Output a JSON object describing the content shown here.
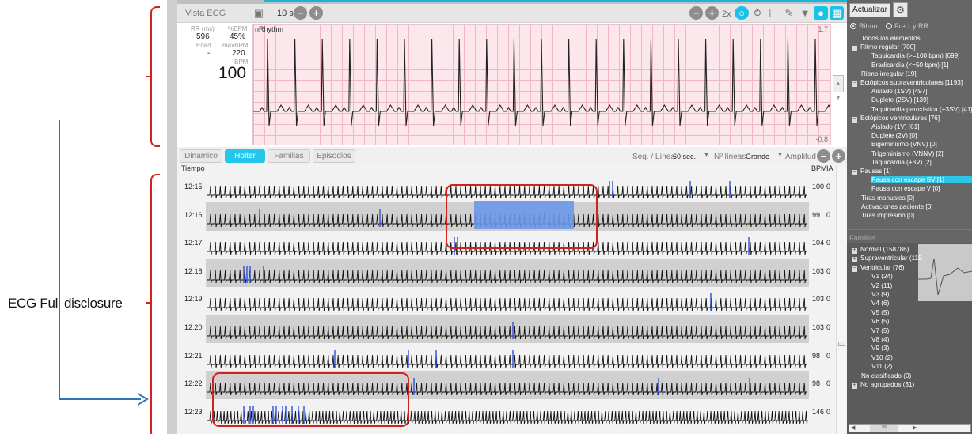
{
  "annotation": {
    "label": "ECG Full disclosure"
  },
  "ecg_toolbar": {
    "title": "Vista ECG",
    "seconds": "10 s",
    "zoom": "2x"
  },
  "ecg_stats": {
    "rr_label": "RR (ms)",
    "rr_value": "596",
    "pbpm_label": "%BPM",
    "pbpm_value": "45%",
    "age_label": "Edad",
    "age_value": "-",
    "maxbpm_label": "maxBPM",
    "maxbpm_value": "220",
    "bpm_label": "BPM",
    "bpm_value": "100"
  },
  "ecg_strip": {
    "rhythm": "nRhythm",
    "scale_top": "1,7",
    "scale_bottom": "-0,8"
  },
  "tabs": [
    {
      "label": "Dinámico",
      "active": false
    },
    {
      "label": "Holter",
      "active": true
    },
    {
      "label": "Familias",
      "active": false
    },
    {
      "label": "Episodios",
      "active": false
    }
  ],
  "holter_controls": {
    "seg_label": "Seg. / Línea",
    "seg_value": "60 sec.",
    "lines_label": "Nº líneas",
    "lines_value": "Grande",
    "amp_label": "Amplitud"
  },
  "holter_header": {
    "time": "Tiempo",
    "bpm": "BPM",
    "ia": "IA"
  },
  "holter_rows": [
    {
      "time": "12:15",
      "bpm": "100",
      "ia": "0"
    },
    {
      "time": "12:16",
      "bpm": "99",
      "ia": "0"
    },
    {
      "time": "12:17",
      "bpm": "104",
      "ia": "0"
    },
    {
      "time": "12:18",
      "bpm": "103",
      "ia": "0"
    },
    {
      "time": "12:19",
      "bpm": "103",
      "ia": "0"
    },
    {
      "time": "12:20",
      "bpm": "103",
      "ia": "0"
    },
    {
      "time": "12:21",
      "bpm": "98",
      "ia": "0"
    },
    {
      "time": "12:22",
      "bpm": "98",
      "ia": "0"
    },
    {
      "time": "12:23",
      "bpm": "146",
      "ia": "0"
    }
  ],
  "sidebar": {
    "update_button": "Actualizar",
    "radio_rhythm": "Ritmo",
    "radio_freq": "Frec. y RR",
    "tree": [
      {
        "label": "Todos los elementos",
        "level": 0,
        "toggle": ""
      },
      {
        "label": "Ritmo regular [700]",
        "level": 0,
        "toggle": "−"
      },
      {
        "label": "Taquicardia (>=100 bpm) [699]",
        "level": 2,
        "toggle": ""
      },
      {
        "label": "Bradicardia (<=50 bpm) [1]",
        "level": 2,
        "toggle": ""
      },
      {
        "label": "Ritmo irregular [19]",
        "level": 0,
        "toggle": ""
      },
      {
        "label": "Ectópicos supraventriculares [1193]",
        "level": 0,
        "toggle": "−"
      },
      {
        "label": "Aislado (1SV) [497]",
        "level": 1,
        "toggle": ""
      },
      {
        "label": "Duplete (2SV) [139]",
        "level": 1,
        "toggle": ""
      },
      {
        "label": "Taquicardia paroxística (+3SV) [41]",
        "level": 1,
        "toggle": ""
      },
      {
        "label": "Ectópicos ventriculares [76]",
        "level": 0,
        "toggle": "−"
      },
      {
        "label": "Aislado (1V) [61]",
        "level": 1,
        "toggle": ""
      },
      {
        "label": "Duplete (2V) [0]",
        "level": 1,
        "toggle": ""
      },
      {
        "label": "Bigeminismo (VNV) [0]",
        "level": 1,
        "toggle": ""
      },
      {
        "label": "Trigeminismo (VNNV) [2]",
        "level": 1,
        "toggle": ""
      },
      {
        "label": "Taquicardia (+3V) [2]",
        "level": 1,
        "toggle": ""
      },
      {
        "label": "Pausas [1]",
        "level": 0,
        "toggle": "−"
      },
      {
        "label": "Pausa con escape SV [1]",
        "level": 1,
        "toggle": "",
        "selected": true
      },
      {
        "label": "Pausa con escape V [0]",
        "level": 1,
        "toggle": ""
      },
      {
        "label": "Tiras manuales [0]",
        "level": 0,
        "toggle": ""
      },
      {
        "label": "Activaciones paciente [0]",
        "level": 0,
        "toggle": ""
      },
      {
        "label": "Tiras impresión [0]",
        "level": 0,
        "toggle": ""
      }
    ],
    "families_header": "Familias",
    "families": [
      {
        "label": "Normal (158786)",
        "level": 0,
        "toggle": "+"
      },
      {
        "label": "Supraventricular (119",
        "level": 0,
        "toggle": "+"
      },
      {
        "label": "Ventricular (76)",
        "level": 0,
        "toggle": "−"
      },
      {
        "label": "V1 (24)",
        "level": 1,
        "toggle": ""
      },
      {
        "label": "V2 (11)",
        "level": 1,
        "toggle": ""
      },
      {
        "label": "V3 (9)",
        "level": 1,
        "toggle": ""
      },
      {
        "label": "V4 (6)",
        "level": 1,
        "toggle": ""
      },
      {
        "label": "V5 (5)",
        "level": 1,
        "toggle": ""
      },
      {
        "label": "V6 (5)",
        "level": 1,
        "toggle": ""
      },
      {
        "label": "V7 (5)",
        "level": 1,
        "toggle": ""
      },
      {
        "label": "V8 (4)",
        "level": 1,
        "toggle": ""
      },
      {
        "label": "V9 (3)",
        "level": 1,
        "toggle": ""
      },
      {
        "label": "V10 (2)",
        "level": 1,
        "toggle": ""
      },
      {
        "label": "V11 (2)",
        "level": 1,
        "toggle": ""
      },
      {
        "label": "No clasificado (0)",
        "level": 0,
        "toggle": ""
      },
      {
        "label": "No agrupados (31)",
        "level": 0,
        "toggle": "+"
      }
    ],
    "hscroll_thumb": "III"
  },
  "colors": {
    "accent": "#25c6ea",
    "annotation_red": "#d62020",
    "arrow_blue": "#2e75b6",
    "ectopic_beat": "#2f4fd8",
    "selection": "#6b98e8"
  }
}
